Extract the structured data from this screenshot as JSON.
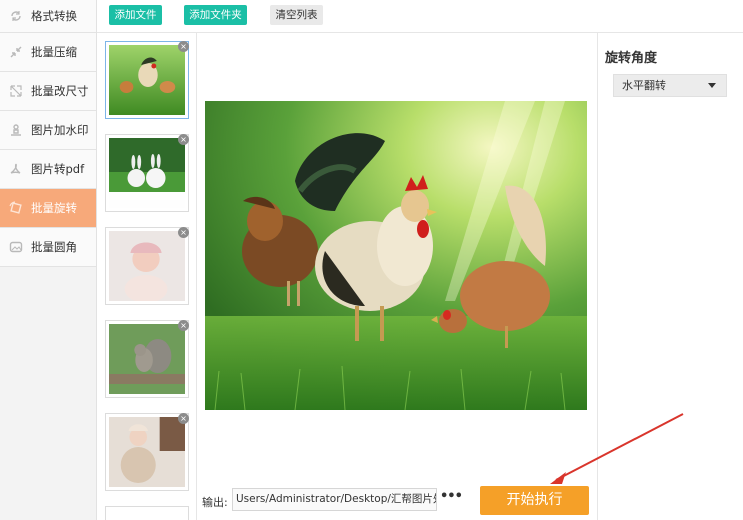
{
  "sidebar": {
    "items": [
      {
        "label": "格式转换",
        "icon": "format-convert-icon",
        "active": false
      },
      {
        "label": "批量压缩",
        "icon": "compress-icon",
        "active": false
      },
      {
        "label": "批量改尺寸",
        "icon": "resize-icon",
        "active": false
      },
      {
        "label": "图片加水印",
        "icon": "watermark-icon",
        "active": false
      },
      {
        "label": "图片转pdf",
        "icon": "pdf-icon",
        "active": false
      },
      {
        "label": "批量旋转",
        "icon": "rotate-icon",
        "active": true
      },
      {
        "label": "批量圆角",
        "icon": "round-corner-icon",
        "active": false
      }
    ]
  },
  "toolbar": {
    "add_file": "添加文件",
    "add_folder": "添加文件夹",
    "clear_list": "清空列表"
  },
  "thumbnails": [
    {
      "subject": "chickens",
      "selected": true
    },
    {
      "subject": "rabbits",
      "selected": false
    },
    {
      "subject": "baby",
      "selected": false
    },
    {
      "subject": "squirrel",
      "selected": false
    },
    {
      "subject": "child",
      "selected": false
    }
  ],
  "output": {
    "label": "输出:",
    "path": "Users/Administrator/Desktop/汇帮图片处理器",
    "more": "•••"
  },
  "start_button": "开始执行",
  "right_panel": {
    "title": "旋转角度",
    "selected_option": "水平翻转"
  },
  "colors": {
    "accent_teal": "#1bbfa6",
    "active_orange": "#f7a97a",
    "start_orange": "#f5a028",
    "annotation_red": "#d9352c"
  }
}
